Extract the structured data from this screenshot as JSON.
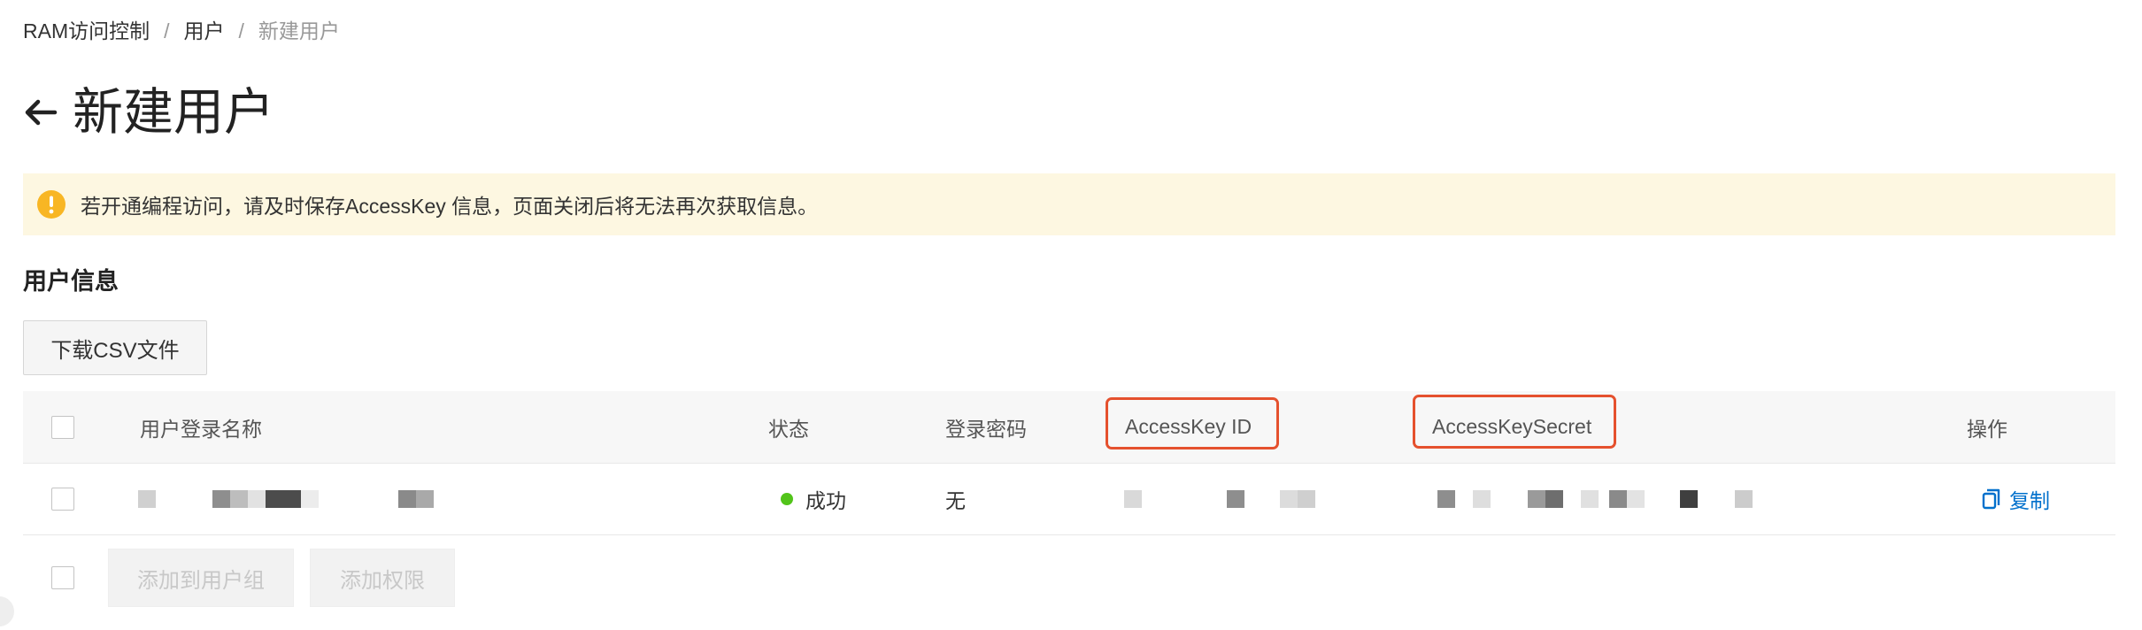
{
  "breadcrumb": {
    "items": [
      "RAM访问控制",
      "用户",
      "新建用户"
    ],
    "separator": "/"
  },
  "header": {
    "title": "新建用户",
    "back_icon": "arrow-left-icon"
  },
  "alert": {
    "icon": "warning-icon",
    "text": "若开通编程访问，请及时保存AccessKey 信息，页面关闭后将无法再次获取信息。",
    "background": "#fdf7e1",
    "icon_color": "#f8b624"
  },
  "section": {
    "title": "用户信息"
  },
  "toolbar": {
    "download_label": "下载CSV文件"
  },
  "table": {
    "columns": {
      "login_name": "用户登录名称",
      "status": "状态",
      "password": "登录密码",
      "access_key_id": "AccessKey ID",
      "access_key_secret": "AccessKeySecret",
      "actions": "操作"
    },
    "highlight_color": "#e5512e",
    "rows": [
      {
        "login_name": "",
        "status": "成功",
        "status_color": "#52c41a",
        "password": "无",
        "access_key_id": "",
        "access_key_secret": "",
        "action": "复制",
        "action_icon": "copy-icon"
      }
    ]
  },
  "footer": {
    "add_to_group_label": "添加到用户组",
    "add_permission_label": "添加权限"
  },
  "colors": {
    "link": "#0070cc",
    "text": "#333333",
    "muted": "#999999"
  }
}
